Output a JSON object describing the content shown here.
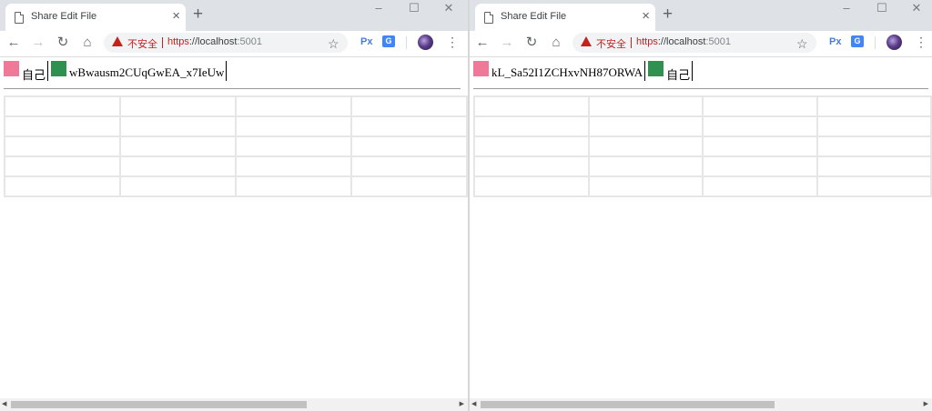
{
  "windows": {
    "left": {
      "tab_title": "Share Edit File",
      "security_text": "不安全",
      "url_scheme": "https",
      "url_rest": "://localhost",
      "url_port": ":5001",
      "users": [
        {
          "name": "自己",
          "color": "#f0799a"
        },
        {
          "name": "wBwausm2CUqGwEA_x7IeUw",
          "color": "#2e9150"
        }
      ]
    },
    "right": {
      "tab_title": "Share Edit File",
      "security_text": "不安全",
      "url_scheme": "https",
      "url_rest": "://localhost",
      "url_port": ":5001",
      "users": [
        {
          "name": "kL_Sa52I1ZCHxvNH87ORWA",
          "color": "#f0799a"
        },
        {
          "name": "自己",
          "color": "#2e9150"
        }
      ]
    }
  },
  "icons": {
    "tab_close": "×",
    "new_tab": "+",
    "minimize": "–",
    "maximize": "☐",
    "close": "✕",
    "back": "←",
    "forward": "→",
    "reload": "↻",
    "home": "⌂",
    "star": "☆",
    "menu": "⋮",
    "ext_px": "Px",
    "ext_tr": "G",
    "arrow_left": "◀",
    "arrow_right": "▶"
  },
  "grid": {
    "rows": 5,
    "cols": 4
  }
}
